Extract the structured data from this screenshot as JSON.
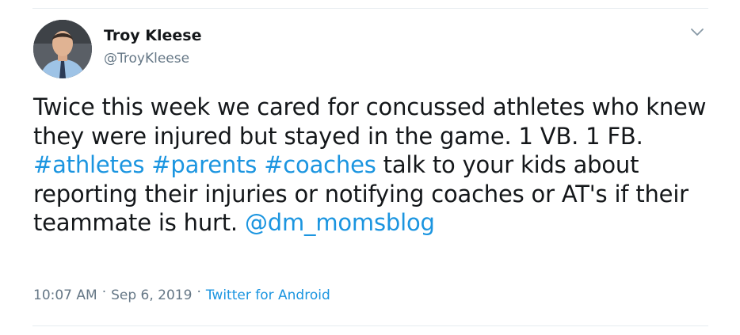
{
  "author": {
    "name": "Troy Kleese",
    "handle": "@TroyKleese"
  },
  "tweet": {
    "text_1": "Twice this week we cared for concussed athletes who knew they were injured but stayed in the game. 1 VB. 1 FB.  ",
    "hashtag_1": "#athletes",
    "space_1": " ",
    "hashtag_2": "#parents",
    "space_2": " ",
    "hashtag_3": "#coaches",
    "text_2": " talk to your kids about reporting their injuries or notifying coaches or AT's if their teammate is hurt. ",
    "mention_1": "@dm_momsblog"
  },
  "meta": {
    "time": "10:07 AM",
    "separator": "·",
    "date": "Sep 6, 2019",
    "source": "Twitter for Android"
  },
  "colors": {
    "text": "#14171a",
    "secondary": "#657786",
    "link": "#1b95e0",
    "divider": "#e6ecf0"
  },
  "icons": {
    "more": "chevron-down-icon"
  }
}
